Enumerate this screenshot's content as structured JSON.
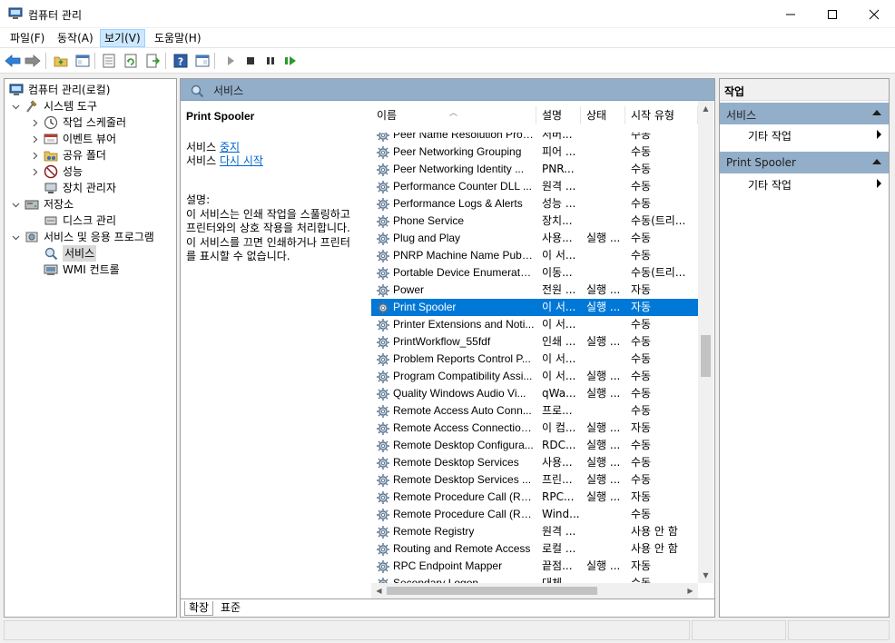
{
  "window": {
    "title": "컴퓨터 관리"
  },
  "menu": [
    "파일(F)",
    "동작(A)",
    "보기(V)",
    "도움말(H)"
  ],
  "menu_active_index": 2,
  "tree": [
    {
      "label": "컴퓨터 관리(로컬)",
      "icon": "computer-management-icon",
      "level": 0,
      "chevron": ""
    },
    {
      "label": "시스템 도구",
      "icon": "system-tools-icon",
      "level": 1,
      "chevron": "down"
    },
    {
      "label": "작업 스케줄러",
      "icon": "task-scheduler-icon",
      "level": 2,
      "chevron": "right"
    },
    {
      "label": "이벤트 뷰어",
      "icon": "event-viewer-icon",
      "level": 2,
      "chevron": "right"
    },
    {
      "label": "공유 폴더",
      "icon": "shared-folders-icon",
      "level": 2,
      "chevron": "right"
    },
    {
      "label": "성능",
      "icon": "performance-icon",
      "level": 2,
      "chevron": "right"
    },
    {
      "label": "장치 관리자",
      "icon": "device-manager-icon",
      "level": 2,
      "chevron": ""
    },
    {
      "label": "저장소",
      "icon": "storage-icon",
      "level": 1,
      "chevron": "down"
    },
    {
      "label": "디스크 관리",
      "icon": "disk-management-icon",
      "level": 2,
      "chevron": ""
    },
    {
      "label": "서비스 및 응용 프로그램",
      "icon": "services-apps-icon",
      "level": 1,
      "chevron": "down"
    },
    {
      "label": "서비스",
      "icon": "services-icon",
      "level": 2,
      "chevron": "",
      "selected": true
    },
    {
      "label": "WMI 컨트롤",
      "icon": "wmi-control-icon",
      "level": 2,
      "chevron": ""
    }
  ],
  "center": {
    "header_title": "서비스",
    "selected_service": "Print Spooler",
    "stop_prefix": "서비스 ",
    "stop_link": "중지",
    "restart_prefix": "서비스 ",
    "restart_link": "다시 시작",
    "description_label": "설명:",
    "description_lines": [
      "이 서비스는 인쇄 작업을 스풀링하고",
      "프린터와의 상호 작용을 처리합니다.",
      "이 서비스를 끄면 인쇄하거나 프린터",
      "를 표시할 수 없습니다."
    ]
  },
  "columns": {
    "name": "이름",
    "desc": "설명",
    "status": "상태",
    "start": "시작 유형"
  },
  "services": [
    {
      "name": "Peer Name Resolution Prot...",
      "desc": "서버...",
      "status": "",
      "start": "수동"
    },
    {
      "name": "Peer Networking Grouping",
      "desc": "피어 ...",
      "status": "",
      "start": "수동"
    },
    {
      "name": "Peer Networking Identity ...",
      "desc": "PNR...",
      "status": "",
      "start": "수동"
    },
    {
      "name": "Performance Counter DLL ...",
      "desc": "원격 ...",
      "status": "",
      "start": "수동"
    },
    {
      "name": "Performance Logs & Alerts",
      "desc": "성능 ...",
      "status": "",
      "start": "수동"
    },
    {
      "name": "Phone Service",
      "desc": "장치...",
      "status": "",
      "start": "수동(트리..."
    },
    {
      "name": "Plug and Play",
      "desc": "사용...",
      "status": "실행 ...",
      "start": "수동"
    },
    {
      "name": "PNRP Machine Name Publi...",
      "desc": "이 서...",
      "status": "",
      "start": "수동"
    },
    {
      "name": "Portable Device Enumerato...",
      "desc": "이동...",
      "status": "",
      "start": "수동(트리..."
    },
    {
      "name": "Power",
      "desc": "전원 ...",
      "status": "실행 ...",
      "start": "자동"
    },
    {
      "name": "Print Spooler",
      "desc": "이 서...",
      "status": "실행 ...",
      "start": "자동",
      "selected": true
    },
    {
      "name": "Printer Extensions and Noti...",
      "desc": "이 서...",
      "status": "",
      "start": "수동"
    },
    {
      "name": "PrintWorkflow_55fdf",
      "desc": "인쇄 ...",
      "status": "실행 ...",
      "start": "수동"
    },
    {
      "name": "Problem Reports Control P...",
      "desc": "이 서...",
      "status": "",
      "start": "수동"
    },
    {
      "name": "Program Compatibility Assi...",
      "desc": "이 서...",
      "status": "실행 ...",
      "start": "수동"
    },
    {
      "name": "Quality Windows Audio Vi...",
      "desc": "qWa...",
      "status": "실행 ...",
      "start": "수동"
    },
    {
      "name": "Remote Access Auto Conn...",
      "desc": "프로...",
      "status": "",
      "start": "수동"
    },
    {
      "name": "Remote Access Connection...",
      "desc": "이 컴...",
      "status": "실행 ...",
      "start": "자동"
    },
    {
      "name": "Remote Desktop Configura...",
      "desc": "RDC...",
      "status": "실행 ...",
      "start": "수동"
    },
    {
      "name": "Remote Desktop Services",
      "desc": "사용...",
      "status": "실행 ...",
      "start": "수동"
    },
    {
      "name": "Remote Desktop Services ...",
      "desc": "프린...",
      "status": "실행 ...",
      "start": "수동"
    },
    {
      "name": "Remote Procedure Call (RP...",
      "desc": "RPC...",
      "status": "실행 ...",
      "start": "자동"
    },
    {
      "name": "Remote Procedure Call (RP...",
      "desc": "Wind...",
      "status": "",
      "start": "수동"
    },
    {
      "name": "Remote Registry",
      "desc": "원격 ...",
      "status": "",
      "start": "사용 안 함"
    },
    {
      "name": "Routing and Remote Access",
      "desc": "로컬 ...",
      "status": "",
      "start": "사용 안 함"
    },
    {
      "name": "RPC Endpoint Mapper",
      "desc": "끝점...",
      "status": "실행 ...",
      "start": "자동"
    },
    {
      "name": "Secondary Logon",
      "desc": "대체 ...",
      "status": "",
      "start": "수동"
    }
  ],
  "tabs": [
    "확장",
    "표준"
  ],
  "actions": {
    "title": "작업",
    "sections": [
      {
        "label": "서비스",
        "item": "기타 작업"
      },
      {
        "label": "Print Spooler",
        "item": "기타 작업"
      }
    ]
  },
  "colors": {
    "selection": "#0078d7",
    "header": "#93aec9",
    "link": "#0066cc"
  }
}
